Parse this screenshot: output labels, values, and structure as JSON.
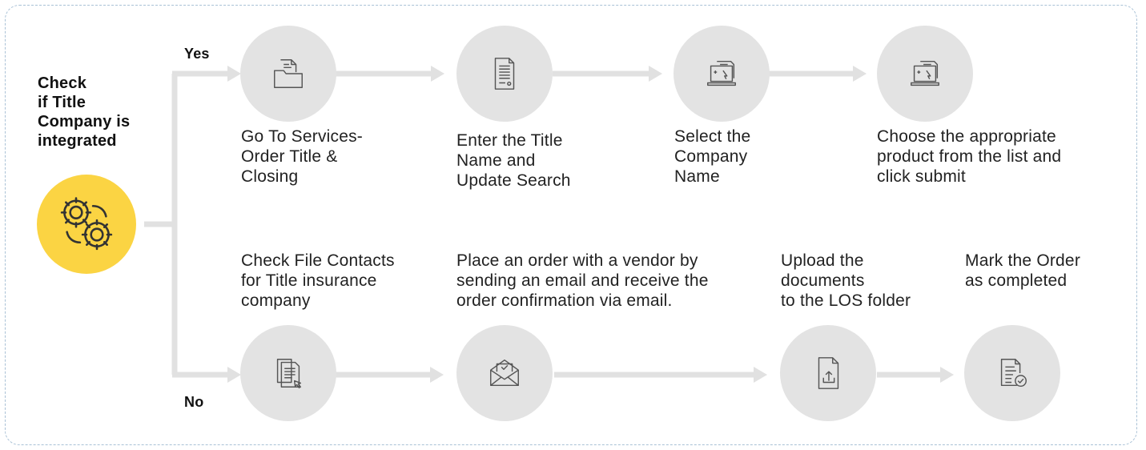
{
  "decision": {
    "label": "Check\nif Title\nCompany is\nintegrated",
    "icon": "gears-icon",
    "yes_label": "Yes",
    "no_label": "No"
  },
  "yes_branch": [
    {
      "label": "Go To Services-\nOrder Title &\nClosing",
      "icon": "folder-document-icon"
    },
    {
      "label": "Enter the Title\nName and\nUpdate Search",
      "icon": "document-icon"
    },
    {
      "label": "Select the\nCompany\nName",
      "icon": "laptop-document-icon"
    },
    {
      "label": "Choose the appropriate\nproduct from the list and\nclick submit",
      "icon": "laptop-document-icon"
    }
  ],
  "no_branch": [
    {
      "label": "Check File Contacts\nfor Title insurance\ncompany",
      "icon": "documents-cursor-icon"
    },
    {
      "label": "Place an order with a vendor by\nsending an email and receive the\norder confirmation via email.",
      "icon": "envelope-check-icon"
    },
    {
      "label": "Upload the\ndocuments\nto the LOS folder",
      "icon": "file-upload-icon"
    },
    {
      "label": "Mark the Order\nas completed",
      "icon": "document-check-icon"
    }
  ],
  "colors": {
    "accent": "#fbd443",
    "node": "#e3e3e3",
    "connector": "#e1e1e1",
    "border": "#a9c1d6"
  }
}
